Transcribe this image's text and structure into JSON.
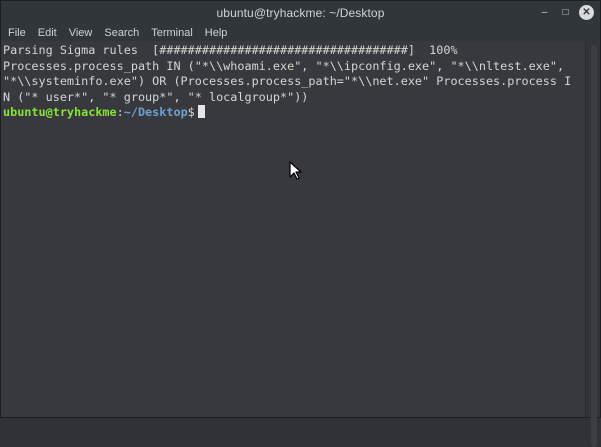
{
  "window": {
    "title": "ubuntu@tryhackme: ~/Desktop",
    "controls": {
      "minimize": "–",
      "maximize": "□",
      "close": "✕"
    }
  },
  "menubar": {
    "items": [
      "File",
      "Edit",
      "View",
      "Search",
      "Terminal",
      "Help"
    ]
  },
  "terminal": {
    "lines": [
      "Parsing Sigma rules  [###################################]  100%",
      "Processes.process_path IN (\"*\\\\whoami.exe\", \"*\\\\ipconfig.exe\", \"*\\\\nltest.exe\",",
      "\"*\\\\systeminfo.exe\") OR (Processes.process_path=\"*\\\\net.exe\" Processes.process I",
      "N (\"* user*\", \"* group*\", \"* localgroup*\"))"
    ],
    "prompt": {
      "user_host": "ubuntu@tryhackme",
      "separator": ":",
      "path": "~/Desktop",
      "symbol": "$"
    }
  },
  "colors": {
    "terminal_bg": "#37393f",
    "text": "#d3d7cf",
    "prompt_user": "#8ae234",
    "prompt_path": "#729fcf"
  },
  "icons": {
    "pointer": "mouse-pointer-icon"
  }
}
